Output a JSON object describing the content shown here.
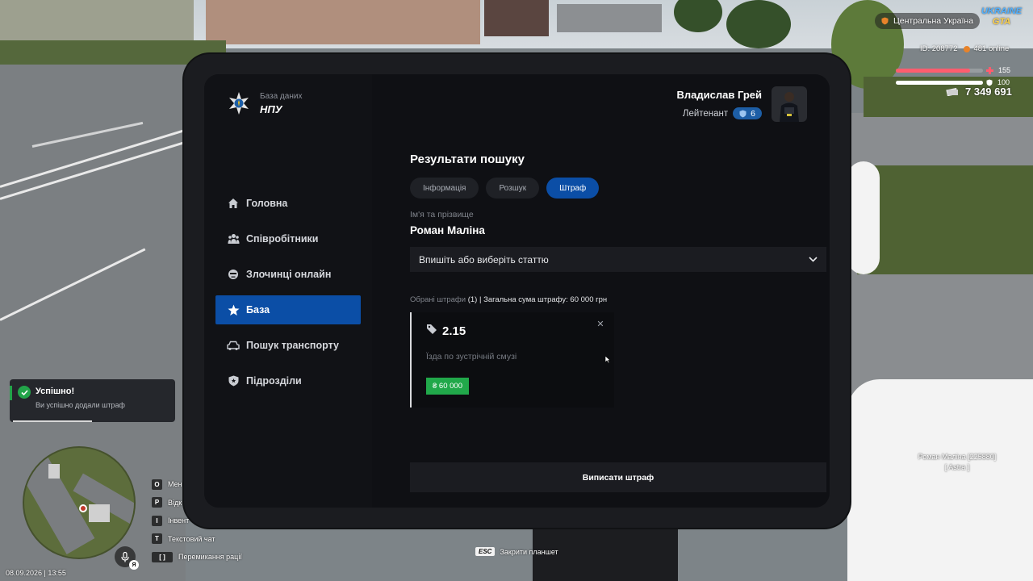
{
  "tablet": {
    "logo_subtitle": "База даних",
    "logo_title": "НПУ",
    "nav": [
      {
        "label": "Головна",
        "icon": "home-icon"
      },
      {
        "label": "Співробітники",
        "icon": "staff-icon"
      },
      {
        "label": "Злочинці онлайн",
        "icon": "criminal-icon"
      },
      {
        "label": "База",
        "icon": "star-icon",
        "active": true
      },
      {
        "label": "Пошук транспорту",
        "icon": "car-icon"
      },
      {
        "label": "Підрозділи",
        "icon": "shield-icon"
      }
    ],
    "user": {
      "name": "Владислав Грей",
      "rank": "Лейтенант",
      "rank_level": "6"
    },
    "heading": "Результати пошуку",
    "tabs": [
      {
        "label": "Інформація"
      },
      {
        "label": "Розшук"
      },
      {
        "label": "Штраф",
        "active": true
      }
    ],
    "name_label": "Ім'я та прізвище",
    "name_value": "Роман Маліна",
    "article_placeholder": "Впишіть або виберіть статтю",
    "summary": {
      "prefix": "Обрані штрафи",
      "count": "(1)",
      "total": "| Загальна сума штрафу: 60 000 грн"
    },
    "fine": {
      "code": "2.15",
      "description": "Їзда по зустрічній смузі",
      "amount": "₴ 60 000"
    },
    "submit_label": "Виписати штраф"
  },
  "hud": {
    "region": "Центральна Україна",
    "logo_line1": "UKRAINE",
    "logo_line2": "GTA",
    "player_id": "ID: 208772",
    "online": "481 online",
    "health": "155",
    "armor": "100",
    "health_fill": 0.85,
    "armor_fill": 1.0,
    "money": "7 349 691",
    "toast_title": "Успішно!",
    "toast_text": "Ви успішно додали штраф",
    "keys": [
      {
        "key": "O",
        "label": "Мен"
      },
      {
        "key": "P",
        "label": "Відк"
      },
      {
        "key": "I",
        "label": "Інвент"
      },
      {
        "key": "T",
        "label": "Текстовий чат"
      },
      {
        "key": "[ ]",
        "label": "Перемикання рації"
      }
    ],
    "mic_key": "Я",
    "datetime": "08.09.2026 | 13:55",
    "esc_key": "ESC",
    "esc_label": "Закрити планшет",
    "nametag_line1": "Роман Маліна [225880]",
    "nametag_line2": "[ Astra ]"
  },
  "colors": {
    "accent": "#0b4ea6",
    "success": "#21a84a",
    "panel": "#0f1014"
  }
}
